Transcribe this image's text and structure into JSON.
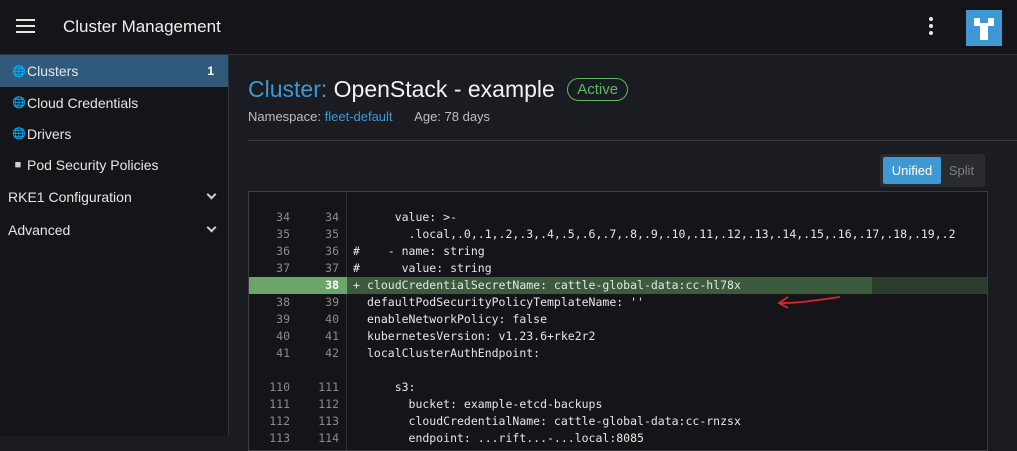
{
  "header": {
    "title": "Cluster Management"
  },
  "sidebar": {
    "items": [
      {
        "label": "Clusters",
        "count": "1",
        "icon": "globe-icon"
      },
      {
        "label": "Cloud Credentials",
        "icon": "globe-icon"
      },
      {
        "label": "Drivers",
        "icon": "globe-icon"
      },
      {
        "label": "Pod Security Policies",
        "icon": "folder-icon"
      }
    ],
    "groups": [
      {
        "label": "RKE1 Configuration"
      },
      {
        "label": "Advanced"
      }
    ]
  },
  "page": {
    "kind": "Cluster:",
    "name": "OpenStack - example",
    "status": "Active",
    "namespace_label": "Namespace:",
    "namespace_value": "fleet-default",
    "age": "Age: 78 days"
  },
  "toggle": {
    "unified": "Unified",
    "split": "Split"
  },
  "diff": {
    "rows": [
      {
        "old": "34",
        "new": "34",
        "mark": "",
        "code": "    value: >-"
      },
      {
        "old": "35",
        "new": "35",
        "mark": "",
        "code": "      .local,.0,.1,.2,.3,.4,.5,.6,.7,.8,.9,.10,.11,.12,.13,.14,.15,.16,.17,.18,.19,.2"
      },
      {
        "old": "36",
        "new": "36",
        "mark": "#",
        "code": "   - name: string"
      },
      {
        "old": "37",
        "new": "37",
        "mark": "#",
        "code": "     value: string"
      },
      {
        "old": "",
        "new": "38",
        "mark": "+",
        "code": "cloudCredentialSecretName: cattle-global-data:cc-hl78x",
        "added": true
      },
      {
        "old": "38",
        "new": "39",
        "mark": "",
        "code": "defaultPodSecurityPolicyTemplateName: ''"
      },
      {
        "old": "39",
        "new": "40",
        "mark": "",
        "code": "enableNetworkPolicy: false"
      },
      {
        "old": "40",
        "new": "41",
        "mark": "",
        "code": "kubernetesVersion: v1.23.6+rke2r2"
      },
      {
        "old": "41",
        "new": "42",
        "mark": "",
        "code": "localClusterAuthEndpoint:"
      },
      {
        "old": "",
        "new": "",
        "mark": "",
        "code": ""
      },
      {
        "old": "110",
        "new": "111",
        "mark": "",
        "code": "    s3:"
      },
      {
        "old": "111",
        "new": "112",
        "mark": "",
        "code": "      bucket: example-etcd-backups"
      },
      {
        "old": "112",
        "new": "113",
        "mark": "",
        "code": "      cloudCredentialName: cattle-global-data:cc-rnzsx"
      },
      {
        "old": "113",
        "new": "114",
        "mark": "",
        "code": "      endpoint: ...rift...-...local:8085"
      }
    ]
  },
  "colors": {
    "accent": "#3d98d3",
    "active_status": "#5ab862",
    "added_line": "#3a5b3c",
    "annotation_arrow": "#d8282c"
  }
}
